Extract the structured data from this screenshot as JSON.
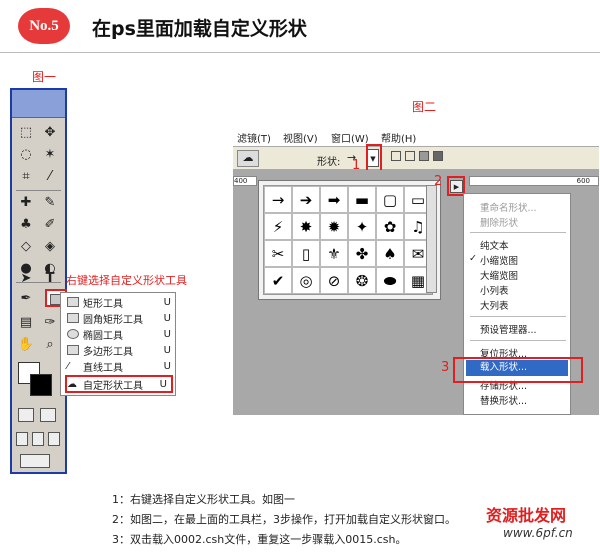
{
  "header": {
    "badge": "No.5",
    "title": "在ps里面加载自定义形状"
  },
  "figure1": {
    "label": "图一",
    "annotation": "右键选择自定义形状工具",
    "menu_items": [
      {
        "label": "矩形工具",
        "key": "U"
      },
      {
        "label": "圆角矩形工具",
        "key": "U"
      },
      {
        "label": "椭圆工具",
        "key": "U"
      },
      {
        "label": "多边形工具",
        "key": "U"
      },
      {
        "label": "直线工具",
        "key": "U"
      },
      {
        "label": "自定形状工具",
        "key": "U"
      }
    ]
  },
  "figure2": {
    "label": "图二",
    "menubar": [
      "滤镜(T)",
      "视图(V)",
      "窗口(W)",
      "帮助(H)"
    ],
    "shape_label": "形状:",
    "ruler_left": "400",
    "ruler_ticks": [
      "",
      "",
      ""
    ],
    "ruler_right": "600",
    "step_numbers": [
      "1",
      "2",
      "3"
    ],
    "shapes": [
      "→",
      "➔",
      "➡",
      "▬",
      "▢",
      "▭",
      "⚡",
      "✸",
      "✹",
      "✦",
      "✿",
      "♫",
      "✂",
      "▯",
      "⚜",
      "✤",
      "♠",
      "✉",
      "✔",
      "◎",
      "⊘",
      "❂",
      "⬬",
      "▦"
    ],
    "panel_menu": {
      "disabled": [
        "重命名形状...",
        "删除形状"
      ],
      "views": [
        "纯文本",
        "小缩览图",
        "大缩览图",
        "小列表",
        "大列表"
      ],
      "checked_view": "小缩览图",
      "manager": "预设管理器...",
      "actions": [
        "复位形状...",
        "载入形状...",
        "存储形状...",
        "替换形状..."
      ],
      "selected_action": "载入形状..."
    }
  },
  "notes": [
    "1：右键选择自定义形状工具。如图一",
    "2：如图二，在最上面的工具栏，3步操作，打开加载自定义形状窗口。",
    "3：双击载入0002.csh文件，重复这一步骤载入0015.csh。"
  ],
  "brand": {
    "name": "资源批发网",
    "url": "www.6pf.cn"
  }
}
